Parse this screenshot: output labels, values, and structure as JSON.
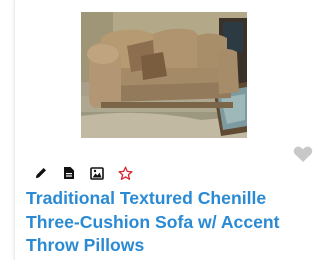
{
  "listing": {
    "title": "Traditional Textured Chenille Three-Cushion Sofa w/ Accent Throw Pillows",
    "title_color": "#2a8ad4",
    "favorite_icon": "heart-icon",
    "favorite_color": "#c8c8c8",
    "actions": [
      {
        "icon": "pencil-icon"
      },
      {
        "icon": "document-icon"
      },
      {
        "icon": "image-icon"
      },
      {
        "icon": "star-icon",
        "color": "#d9232d"
      }
    ]
  }
}
